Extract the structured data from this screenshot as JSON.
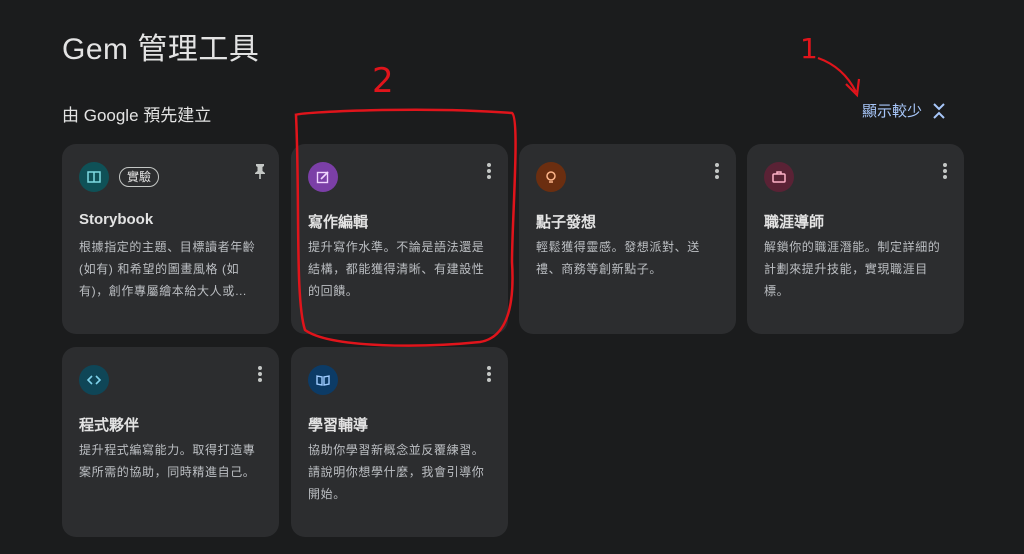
{
  "header": {
    "title": "Gem 管理工具"
  },
  "section": {
    "title": "由 Google 預先建立",
    "toggle_label": "顯示較少"
  },
  "gems": [
    {
      "name": "Storybook",
      "badge": "實驗",
      "description": "根據指定的主題、目標讀者年齡 (如有) 和希望的圖畫風格 (如有)，創作專屬繪本給大人或…",
      "icon": "book-icon",
      "color": "#0f5157"
    },
    {
      "name": "寫作編輯",
      "description": "提升寫作水準。不論是語法還是結構，都能獲得清晰、有建設性的回饋。",
      "icon": "edit-icon",
      "color": "#7b3fa7"
    },
    {
      "name": "點子發想",
      "description": "輕鬆獲得靈感。發想派對、送禮、商務等創新點子。",
      "icon": "lightbulb-icon",
      "color": "#6b2e10"
    },
    {
      "name": "職涯導師",
      "description": "解鎖你的職涯潛能。制定詳細的計劃來提升技能，實現職涯目標。",
      "icon": "briefcase-icon",
      "color": "#5a2235"
    },
    {
      "name": "程式夥伴",
      "description": "提升程式編寫能力。取得打造專案所需的協助，同時精進自己。",
      "icon": "code-icon",
      "color": "#0f4657"
    },
    {
      "name": "學習輔導",
      "description": "協助你學習新概念並反覆練習。請說明你想學什麼，我會引導你開始。",
      "icon": "learning-book-icon",
      "color": "#0c3b66"
    }
  ],
  "annotations": {
    "label_1": "1",
    "label_2": "2"
  },
  "colors": {
    "accent": "#a8c7fa",
    "annotation": "#e0141b"
  }
}
